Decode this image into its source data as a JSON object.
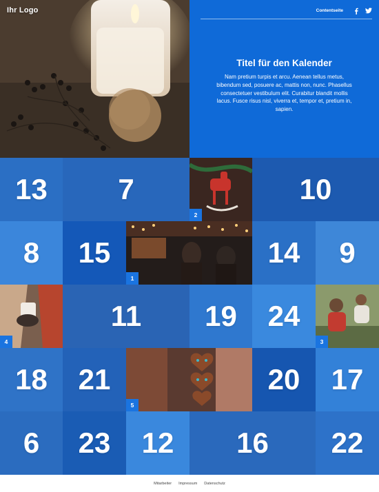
{
  "header": {
    "logo": "Ihr Logo",
    "nav_link": "Contentseite",
    "social": [
      {
        "icon": "facebook-icon",
        "glyph": "f"
      },
      {
        "icon": "twitter-icon"
      }
    ]
  },
  "hero": {
    "title": "Titel für den Kalender",
    "text": "Nam pretium turpis et arcu. Aenean tellus metus, bibendum sed, posuere ac, mattis non, nunc. Phasellus consectetuer vestibulum elit. Curabitur blandit mollis lacus. Fusce risus nisl, viverra et, tempor et, pretium in, sapien."
  },
  "calendar": {
    "doors": [
      {
        "label": "13",
        "tone": "#2b6fc4"
      },
      {
        "label": "7",
        "tone": "#2867bb"
      },
      {
        "label": "2",
        "tone": "#4a2a20",
        "opened": true
      },
      {
        "label": "10",
        "tone": "#1d5ab0"
      },
      {
        "label": "8",
        "tone": "#3b86db"
      },
      {
        "label": "15",
        "tone": "#1458b8"
      },
      {
        "label": "1",
        "tone": "#2b2522",
        "opened": true
      },
      {
        "label": "14",
        "tone": "#2a70c6"
      },
      {
        "label": "9",
        "tone": "#3e87d8"
      },
      {
        "label": "4",
        "tone": "#8b6f5a",
        "opened": true
      },
      {
        "label": "11",
        "tone": "#2a64b4"
      },
      {
        "label": "19",
        "tone": "#2f78cf"
      },
      {
        "label": "24",
        "tone": "#3a89de"
      },
      {
        "label": "3",
        "tone": "#5c6b44",
        "opened": true
      },
      {
        "label": "18",
        "tone": "#2f73c7"
      },
      {
        "label": "21",
        "tone": "#2362b8"
      },
      {
        "label": "5",
        "tone": "#6a3a2a",
        "opened": true
      },
      {
        "label": "20",
        "tone": "#1656b0"
      },
      {
        "label": "17",
        "tone": "#3381d8"
      },
      {
        "label": "6",
        "tone": "#2b6cbf"
      },
      {
        "label": "23",
        "tone": "#1a5cb4"
      },
      {
        "label": "12",
        "tone": "#3a88dd"
      },
      {
        "label": "16",
        "tone": "#2a69bc"
      },
      {
        "label": "22",
        "tone": "#2d72c9"
      }
    ]
  },
  "footer": {
    "links": [
      "Mitarbeiter",
      "Impressum",
      "Datenschutz"
    ]
  }
}
